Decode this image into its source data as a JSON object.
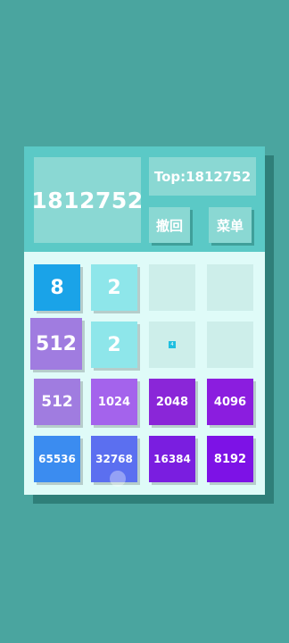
{
  "score": "1812752",
  "top": "Top:1812752",
  "buttons": {
    "undo": "撤回",
    "menu": "菜单"
  },
  "colors": {
    "background": "#4aa59f",
    "header": "#5bc9c6",
    "panel": "#8ad8d3",
    "board": "#dffbf8",
    "empty_cell": "#cdeeea"
  },
  "tiles": {
    "r1c1": {
      "value": "8",
      "color": "#1aa3e8"
    },
    "r1c2": {
      "value": "2",
      "color": "#8ee6ea"
    },
    "r2c1": {
      "value": "512",
      "color": "#a07ce0"
    },
    "r2c2": {
      "value": "2",
      "color": "#8ee6ea"
    },
    "r2c3": {
      "value": "4",
      "color": "#1fbfe0"
    },
    "r3c1": {
      "value": "512",
      "color": "#a07ce0"
    },
    "r3c2": {
      "value": "1024",
      "color": "#a463ec"
    },
    "r3c3": {
      "value": "2048",
      "color": "#8a26d8"
    },
    "r3c4": {
      "value": "4096",
      "color": "#8b1ddf"
    },
    "r4c1": {
      "value": "65536",
      "color": "#3b8cf0"
    },
    "r4c2": {
      "value": "32768",
      "color": "#5b6ff0"
    },
    "r4c3": {
      "value": "16384",
      "color": "#7a1ee0"
    },
    "r4c4": {
      "value": "8192",
      "color": "#7d12e6"
    }
  }
}
